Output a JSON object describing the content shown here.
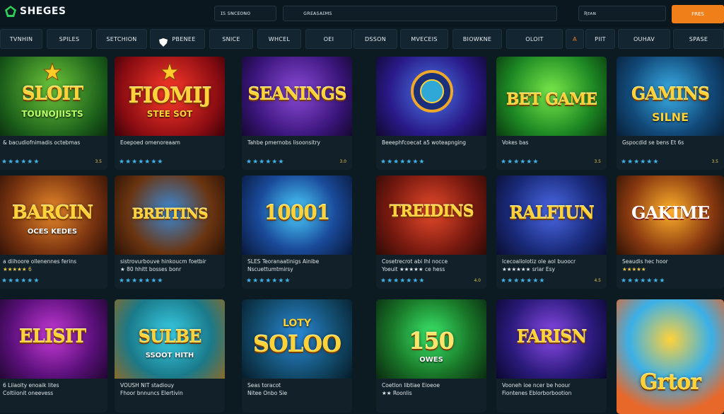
{
  "app": {
    "logo_text": "SHEGES"
  },
  "header": {
    "search_small": "ɪꜱ ꜱɴᴄᴇᴏɴᴏ",
    "search_main": "ɢʀᴇᴀꜱᴀɪᴍꜱ",
    "search_right": "Ʀᴇᴀɴ",
    "cta_label": "FRES"
  },
  "nav": {
    "tabs": [
      {
        "label": "TVNHIN"
      },
      {
        "label": "SPILES"
      },
      {
        "label": "SETCHION"
      },
      {
        "label": "PBENEE"
      },
      {
        "label": "SNICE"
      },
      {
        "label": "WHCEL"
      },
      {
        "label": "OEI"
      },
      {
        "label": "DSSON"
      },
      {
        "label": "MVECEIS"
      },
      {
        "label": "BIOWKNE"
      },
      {
        "label": "OLOIT"
      },
      {
        "label": "A"
      },
      {
        "label": "PIIT"
      },
      {
        "label": "OUHAV"
      },
      {
        "label": "SPASE"
      }
    ]
  },
  "games": [
    {
      "title": "SLOIT",
      "subtitle": "TOUNOJIISTS",
      "desc1": "& bacudiofnimadis octebmas",
      "desc2": "",
      "rating": "3.5"
    },
    {
      "title": "FIOMIJ",
      "subtitle": "STEE SOT",
      "desc1": "Eoepoed omenoreaam",
      "desc2": "",
      "rating": ""
    },
    {
      "title": "SEANINGS",
      "subtitle": "",
      "desc1": "Tahbe pmernobs lisoonsitry",
      "desc2": "",
      "rating": "3.0"
    },
    {
      "title": "",
      "subtitle": "",
      "desc1": "Beeephfcoecat a5 woteapnging",
      "desc2": "",
      "rating": ""
    },
    {
      "title": "BET GAME",
      "subtitle": "",
      "desc1": "Vokes bas",
      "desc2": "",
      "rating": "3.5"
    },
    {
      "title": "GAMINS",
      "subtitle": "SILNE",
      "desc1": "Gspocdid se bens Et 6s",
      "desc2": "",
      "rating": "3.5"
    },
    {
      "title": "BARCIN",
      "subtitle": "OCES KEDES",
      "desc1": "a diihoore ollenennes ferins",
      "desc2": "★★★★★ 6",
      "rating": ""
    },
    {
      "title": "BREITINS",
      "subtitle": "",
      "desc1": "sistrovurbouve hinkoucm foetbir",
      "desc2": "★ 80 hhitt bosses bonr",
      "rating": ""
    },
    {
      "title": "10001",
      "subtitle": "",
      "desc1": "SLES Teoranaatinigs Ainibe",
      "desc2": "Nscuettumtmirsy",
      "rating": ""
    },
    {
      "title": "TREIDINS",
      "subtitle": "",
      "desc1": "Cosetrecrot abi lhl nocce",
      "desc2": "Yoeuit ★★★★★ ce hess",
      "rating": "4.0"
    },
    {
      "title": "RALFIUN",
      "subtitle": "",
      "desc1": "lcecoaliolotiz ole aol buoocr",
      "desc2": "★★★★★★ sriar Esy",
      "rating": "4.5"
    },
    {
      "title": "GAKIME",
      "subtitle": "",
      "desc1": "Seaudis hec hoor",
      "desc2": "★★★★★",
      "rating": ""
    },
    {
      "title": "ELISIT",
      "subtitle": "",
      "desc1": "6 Liiaoity enoaik lites",
      "desc2": "Coltiionit oneevess",
      "rating": ""
    },
    {
      "title": "SULBE",
      "subtitle": "SSOOT HITH",
      "desc1": "VOUSH NIT stadiouy",
      "desc2": "Fhoor bnnuncs Elertivin",
      "rating": ""
    },
    {
      "title": "SOLOO",
      "subtitle": "LOTY",
      "desc1": "Seas toracot",
      "desc2": "Nitee Onbo Sie",
      "rating": ""
    },
    {
      "title": "150",
      "subtitle": "OWES",
      "desc1": "Coetlon libtiae Eioeoe",
      "desc2": "★★ Roonlis",
      "rating": ""
    },
    {
      "title": "FARISN",
      "subtitle": "",
      "desc1": "Vooneh ioe ncer be hoour",
      "desc2": "Fiontenes Eblorborbootion",
      "rating": ""
    },
    {
      "title": "Grtor",
      "subtitle": "",
      "desc1": "",
      "desc2": "",
      "rating": ""
    }
  ],
  "colors": {
    "accent": "#f07f1a",
    "star_blue": "#3fb4e6",
    "bg": "#0c1a22"
  }
}
